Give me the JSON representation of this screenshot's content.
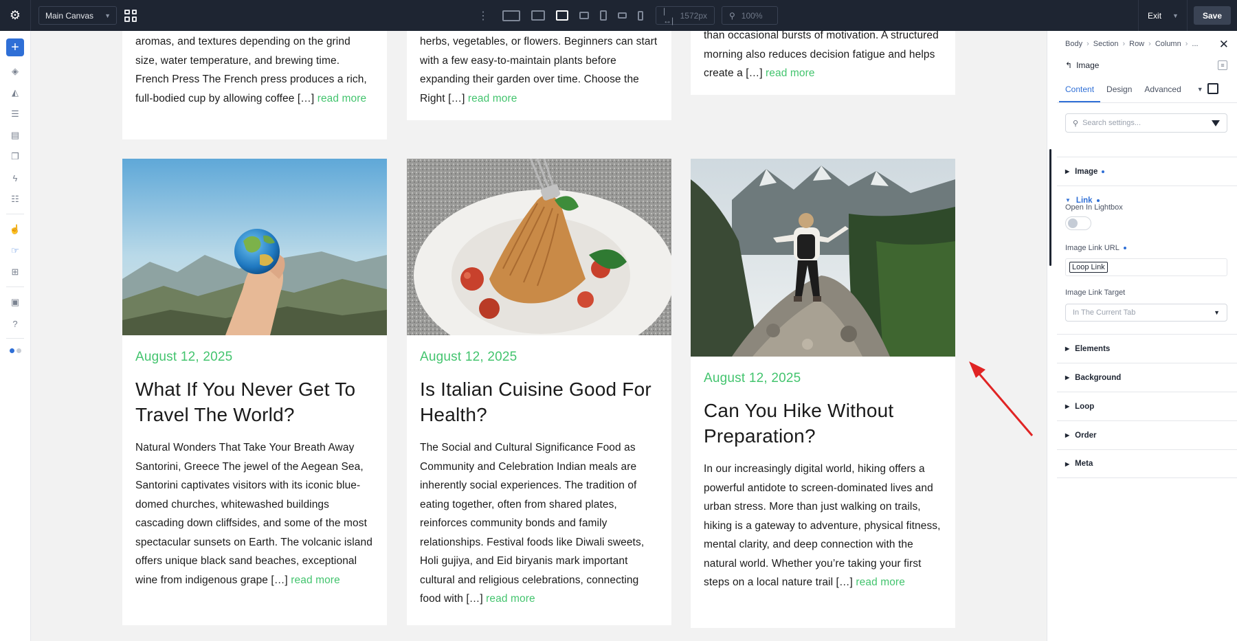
{
  "topbar": {
    "canvas_label": "Main Canvas",
    "width_value": "1572px",
    "zoom_value": "100%",
    "exit_label": "Exit",
    "save_label": "Save"
  },
  "cards_top": [
    {
      "excerpt": "aromas, and textures depending on the grind size, water temperature, and brewing time. French Press The French press produces a rich, full-bodied cup by allowing coffee […] ",
      "read_more": "read more"
    },
    {
      "excerpt": "herbs, vegetables, or flowers. Beginners can start with a few easy-to-maintain plants before expanding their garden over time. Choose the Right […] ",
      "read_more": "read more"
    },
    {
      "excerpt": "than occasional bursts of motivation. A structured morning also reduces decision fatigue and helps create a […] ",
      "read_more": "read more"
    }
  ],
  "cards": [
    {
      "date": "August 12, 2025",
      "title": "What If You Never Get To Travel The World?",
      "excerpt": "Natural Wonders That Take Your Breath Away Santorini, Greece The jewel of the Aegean Sea, Santorini captivates visitors with its iconic blue-domed churches, whitewashed buildings cascading down cliffsides, and some of the most spectacular sunsets on Earth. The volcanic island offers unique black sand beaches, exceptional wine from indigenous grape […] ",
      "read_more": "read more"
    },
    {
      "date": "August 12, 2025",
      "title": "Is Italian Cuisine Good For Health?",
      "excerpt": "The Social and Cultural Significance Food as Community and Celebration Indian meals are inherently social experiences. The tradition of eating together, often from shared plates, reinforces community bonds and family relationships. Festival foods like Diwali sweets, Holi gujiya, and Eid biryanis mark important cultural and religious celebrations, connecting food with […] ",
      "read_more": "read more"
    },
    {
      "date": "August 12, 2025",
      "title": "Can You Hike Without Preparation?",
      "excerpt": "In our increasingly digital world, hiking offers a powerful antidote to screen-dominated lives and urban stress. More than just walking on trails, hiking is a gateway to adventure, physical fitness, mental clarity, and deep connection with the natural world. Whether you’re taking your first steps on a local nature trail […] ",
      "read_more": "read more"
    }
  ],
  "panel": {
    "breadcrumb": [
      "Body",
      "Section",
      "Row",
      "Column",
      "..."
    ],
    "element_name": "Image",
    "tabs": [
      "Content",
      "Design",
      "Advanced"
    ],
    "search_placeholder": "Search settings...",
    "sections": {
      "image": "Image",
      "link": "Link",
      "elements": "Elements",
      "background": "Background",
      "loop": "Loop",
      "order": "Order",
      "meta": "Meta"
    },
    "fields": {
      "open_lightbox_label": "Open In Lightbox",
      "image_link_url_label": "Image Link URL",
      "image_link_url_value": "Loop Link",
      "image_link_target_label": "Image Link Target",
      "image_link_target_value": "In The Current Tab"
    }
  },
  "colors": {
    "accent_green": "#43c46e",
    "accent_blue": "#2f6fd6",
    "topbar_bg": "#1e2532",
    "annotation_red": "#e02424"
  }
}
